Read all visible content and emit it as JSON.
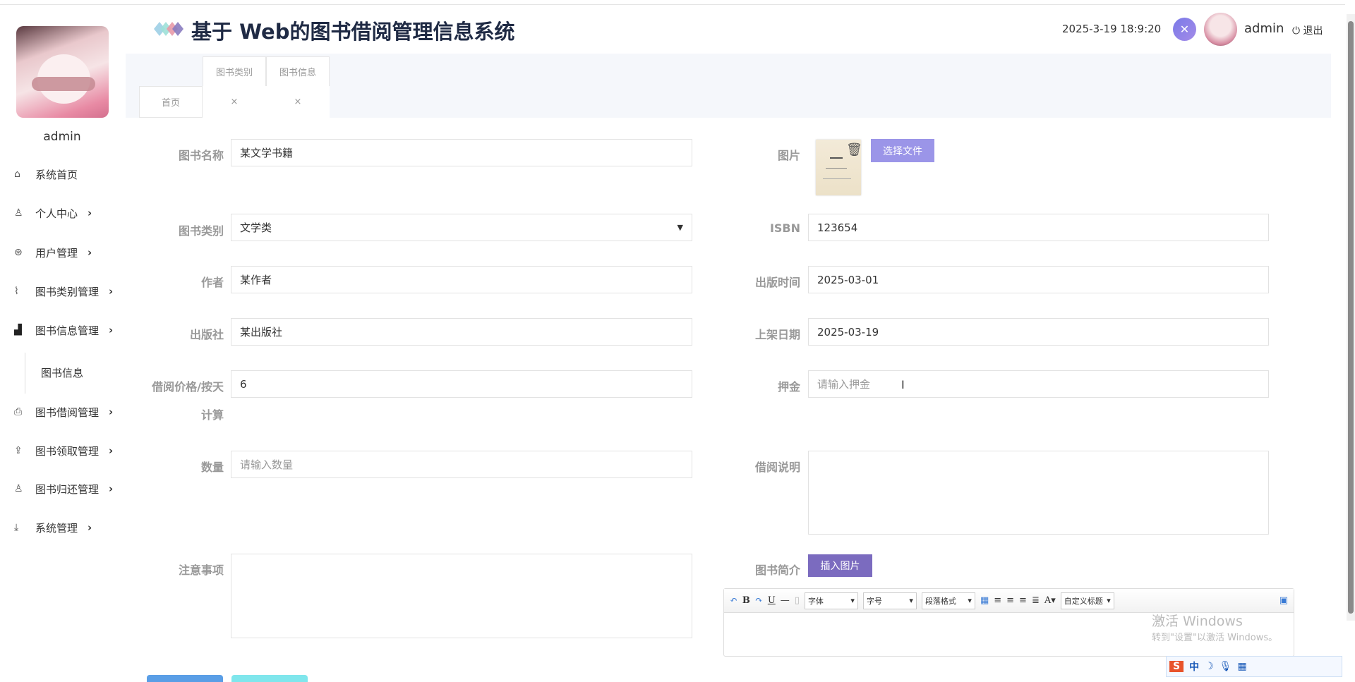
{
  "header": {
    "title": "基于 Web的图书借阅管理信息系统",
    "datetime": "2025-3-19 18:9:20",
    "username": "admin",
    "logout": "退出"
  },
  "sidebar": {
    "username": "admin",
    "items": [
      {
        "label": "系统首页",
        "icon": "home-icon"
      },
      {
        "label": "个人中心",
        "icon": "user-icon"
      },
      {
        "label": "用户管理",
        "icon": "user-circle-icon"
      },
      {
        "label": "图书类别管理",
        "icon": "line-chart-icon"
      },
      {
        "label": "图书信息管理",
        "icon": "bar-chart-icon"
      },
      {
        "label": "图书借阅管理",
        "icon": "print-icon"
      },
      {
        "label": "图书领取管理",
        "icon": "upload-icon"
      },
      {
        "label": "图书归还管理",
        "icon": "user-icon"
      },
      {
        "label": "系统管理",
        "icon": "download-icon"
      }
    ],
    "subitem": "图书信息"
  },
  "tabs": {
    "row1": [
      "图书类别",
      "图书信息"
    ],
    "home": "首页",
    "close": "×"
  },
  "form": {
    "name": {
      "label": "图书名称",
      "value": "某文学书籍"
    },
    "category": {
      "label": "图书类别",
      "value": "文学类"
    },
    "author": {
      "label": "作者",
      "value": "某作者"
    },
    "publisher": {
      "label": "出版社",
      "value": "某出版社"
    },
    "price": {
      "label": "借阅价格/按天",
      "label2": "计算",
      "value": "6"
    },
    "quantity": {
      "label": "数量",
      "placeholder": "请输入数量"
    },
    "notes": {
      "label": "注意事项"
    },
    "image": {
      "label": "图片",
      "button": "选择文件"
    },
    "isbn": {
      "label": "ISBN",
      "value": "123654"
    },
    "pubdate": {
      "label": "出版时间",
      "value": "2025-03-01"
    },
    "shelfdate": {
      "label": "上架日期",
      "value": "2025-03-19"
    },
    "deposit": {
      "label": "押金",
      "placeholder": "请输入押金"
    },
    "desc": {
      "label": "借阅说明"
    },
    "intro": {
      "label": "图书简介",
      "button": "插入图片"
    }
  },
  "editor": {
    "font": "字体",
    "size": "字号",
    "paragraph": "段落格式",
    "custom": "自定义标题"
  },
  "watermark": {
    "line1": "激活 Windows",
    "line2": "转到\"设置\"以激活 Windows。"
  },
  "colors": {
    "file_button": "#9b95e8",
    "insert_button": "#7b6bbf",
    "submit": "#5a9ee6",
    "reset": "#7fe6ec"
  }
}
